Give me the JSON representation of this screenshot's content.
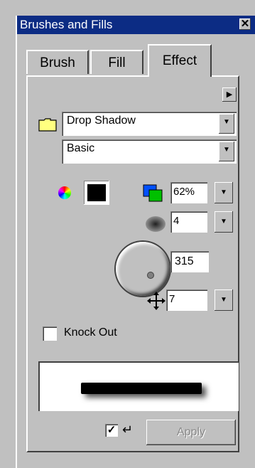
{
  "window": {
    "title": "Brushes and Fills",
    "close_glyph": "✕"
  },
  "tabs": [
    {
      "label": "Brush",
      "active": false
    },
    {
      "label": "Fill",
      "active": false
    },
    {
      "label": "Effect",
      "active": true
    }
  ],
  "effect": {
    "type_select": "Drop Shadow",
    "preset_select": "Basic",
    "color": "#000000",
    "opacity": "62%",
    "blur": "4",
    "angle": "315",
    "distance": "7",
    "knock_out_label": "Knock Out",
    "knock_out_checked": false,
    "apply_label": "Apply",
    "auto_apply_checked": true
  },
  "icons": {
    "menu_arrow": "right-arrow-icon",
    "folder": "folder-icon",
    "color_wheel": "color-wheel-icon",
    "opacity": "opacity-icon",
    "blur": "blur-icon",
    "move": "move-icon",
    "return": "return-icon"
  },
  "colors": {
    "titlebar": "#0c2c84",
    "panel": "#c0c0c0"
  }
}
